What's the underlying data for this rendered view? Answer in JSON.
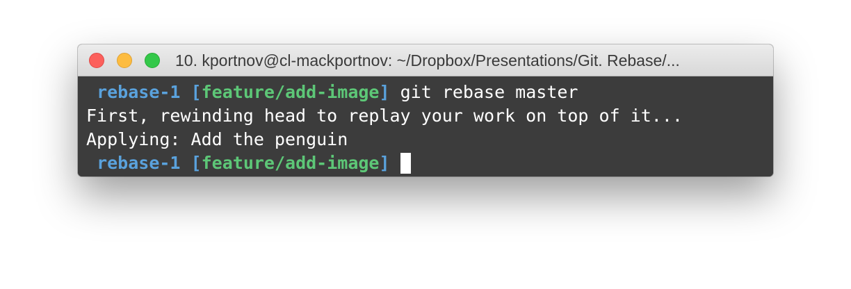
{
  "window": {
    "title": "10. kportnov@cl-mackportnov: ~/Dropbox/Presentations/Git. Rebase/..."
  },
  "traffic_lights": {
    "close_color": "#fc605c",
    "minimize_color": "#fdbc40",
    "maximize_color": "#34c84a"
  },
  "terminal": {
    "lines": [
      {
        "prompt_dir": "rebase-1",
        "bracket_open": "[",
        "branch": "feature/add-image",
        "bracket_close": "]",
        "command": "git rebase master"
      },
      {
        "text": "First, rewinding head to replay your work on top of it..."
      },
      {
        "text": "Applying: Add the penguin"
      },
      {
        "prompt_dir": "rebase-1",
        "bracket_open": "[",
        "branch": "feature/add-image",
        "bracket_close": "]",
        "command": ""
      }
    ],
    "colors": {
      "background": "#3c3c3c",
      "prompt": "#5aa2dd",
      "branch": "#5dc777",
      "text": "#ffffff"
    }
  }
}
